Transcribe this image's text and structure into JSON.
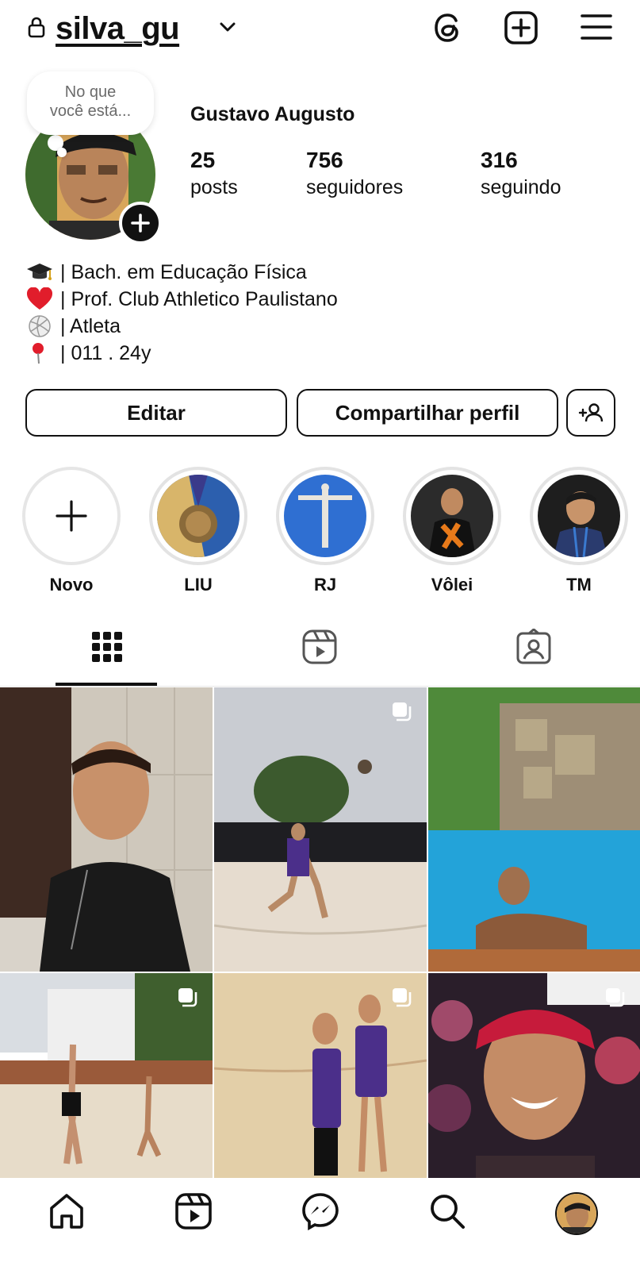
{
  "header": {
    "username": "silva_gu",
    "icons": [
      "lock-icon",
      "chevron-down-icon",
      "threads-icon",
      "new-post-icon",
      "menu-icon"
    ]
  },
  "note": {
    "text_line1": "No que",
    "text_line2": "você está..."
  },
  "profile": {
    "name": "Gustavo Augusto",
    "stats": [
      {
        "value": "25",
        "label": "posts"
      },
      {
        "value": "756",
        "label": "seguidores"
      },
      {
        "value": "316",
        "label": "seguindo"
      }
    ],
    "bio": [
      {
        "icon": "graduation-cap-icon",
        "text": "| Bach. em Educação Física"
      },
      {
        "icon": "red-heart-icon",
        "text": "| Prof. Club Athletico Paulistano"
      },
      {
        "icon": "volleyball-icon",
        "text": "| Atleta"
      },
      {
        "icon": "pin-icon",
        "text": "| 011 . 24y"
      }
    ]
  },
  "actions": {
    "edit_label": "Editar",
    "share_label": "Compartilhar perfil",
    "add_person_icon": "add-person-icon"
  },
  "highlights": [
    {
      "label": "Novo"
    },
    {
      "label": "LIU"
    },
    {
      "label": "RJ"
    },
    {
      "label": "Vôlei"
    },
    {
      "label": "TM"
    }
  ],
  "tabs": [
    "grid-icon",
    "reels-icon",
    "tagged-icon"
  ],
  "grid": [
    {
      "photo": "selfie-black-shirt",
      "multi": false
    },
    {
      "photo": "beach-volleyball-receive",
      "multi": true
    },
    {
      "photo": "swimming-pool",
      "multi": false
    },
    {
      "photo": "beach-volleyball-court",
      "multi": true
    },
    {
      "photo": "beach-volleyball-pair",
      "multi": true
    },
    {
      "photo": "party-selfie-red-cap",
      "multi": true
    }
  ],
  "bottom_nav": [
    "home-icon",
    "reels-icon",
    "messenger-icon",
    "search-icon",
    "profile-avatar"
  ],
  "colors": {
    "accent": "#111111",
    "ring": "#e3e3e3",
    "note_text": "#6b6b6b",
    "heart": "#e11d2b"
  }
}
